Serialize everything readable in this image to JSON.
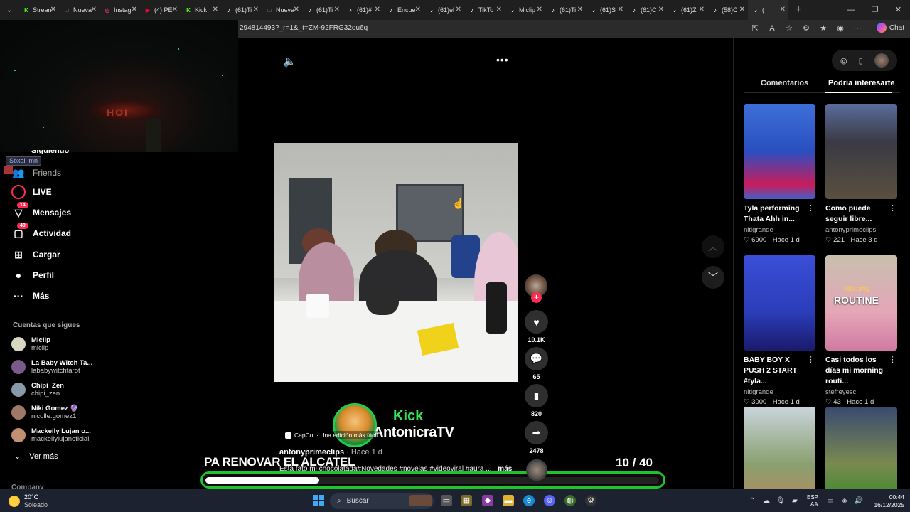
{
  "browser": {
    "tabs": [
      {
        "label": "Strean",
        "icon": "kick-icon",
        "color": "#53fc18",
        "glyph": "K"
      },
      {
        "label": "Nueva",
        "icon": "newtab-icon",
        "color": "#999999",
        "glyph": "□"
      },
      {
        "label": "Instag",
        "icon": "instagram-icon",
        "color": "#e1306c",
        "glyph": "◎"
      },
      {
        "label": "(4) PE",
        "icon": "youtube-icon",
        "color": "#ff0033",
        "glyph": "▶"
      },
      {
        "label": "Kick",
        "icon": "kick-icon",
        "color": "#53fc18",
        "glyph": "K"
      },
      {
        "label": "(61)Ti",
        "icon": "tiktok-icon",
        "color": "#ffffff",
        "glyph": "♪"
      },
      {
        "label": "Nueva",
        "icon": "newtab-icon",
        "color": "#999999",
        "glyph": "□"
      },
      {
        "label": "(61)Ti",
        "icon": "tiktok-icon",
        "color": "#ffffff",
        "glyph": "♪"
      },
      {
        "label": "(61)#",
        "icon": "tiktok-icon",
        "color": "#ffffff",
        "glyph": "♪"
      },
      {
        "label": "Encue",
        "icon": "tiktok-icon",
        "color": "#ffffff",
        "glyph": "♪"
      },
      {
        "label": "(61)el",
        "icon": "tiktok-icon",
        "color": "#ffffff",
        "glyph": "♪"
      },
      {
        "label": "TikTo",
        "icon": "tiktok-icon",
        "color": "#ffffff",
        "glyph": "♪"
      },
      {
        "label": "Miclip",
        "icon": "tiktok-icon",
        "color": "#ffffff",
        "glyph": "♪"
      },
      {
        "label": "(61)Ti",
        "icon": "tiktok-icon",
        "color": "#ffffff",
        "glyph": "♪"
      },
      {
        "label": "(61)S",
        "icon": "tiktok-icon",
        "color": "#ffffff",
        "glyph": "♪"
      },
      {
        "label": "(61)C",
        "icon": "tiktok-icon",
        "color": "#ffffff",
        "glyph": "♪"
      },
      {
        "label": "(61)Z",
        "icon": "tiktok-icon",
        "color": "#ffffff",
        "glyph": "♪"
      },
      {
        "label": "(58)C",
        "icon": "tiktok-icon",
        "color": "#ffffff",
        "glyph": "♪"
      },
      {
        "label": "(",
        "icon": "tiktok-icon",
        "color": "#ffffff",
        "glyph": "♪",
        "active": true
      }
    ],
    "url": "294814493?_r=1&_t=ZM-92FRG32ou6q",
    "copilot_label": "Chat"
  },
  "stream_overlay": {
    "username": "Sbxal_mn",
    "sign_text": "HOI"
  },
  "sidebar": {
    "partial_top": "Siguiendo",
    "nav": [
      {
        "label": "Friends",
        "icon": "friends-icon",
        "glyph": "👥",
        "dim": true
      },
      {
        "label": "LIVE",
        "icon": "live-icon",
        "glyph": ""
      },
      {
        "label": "Mensajes",
        "icon": "messages-icon",
        "glyph": "▽",
        "badge": "14"
      },
      {
        "label": "Actividad",
        "icon": "activity-icon",
        "glyph": "▢",
        "badge": "40"
      },
      {
        "label": "Cargar",
        "icon": "upload-icon",
        "glyph": "⊞"
      },
      {
        "label": "Perfil",
        "icon": "profile-icon",
        "glyph": "●"
      },
      {
        "label": "Más",
        "icon": "more-icon",
        "glyph": "···"
      }
    ],
    "following_title": "Cuentas que sigues",
    "following": [
      {
        "name": "Miclip",
        "handle": "miclip",
        "color": "#d8d8c0"
      },
      {
        "name": "La Baby Witch Ta...",
        "handle": "lababywitchtarot",
        "color": "#7a5a8a"
      },
      {
        "name": "Chipi_Zen",
        "handle": "chipi_zen",
        "color": "#8899aa"
      },
      {
        "name": "Niki Gomez 🔮",
        "handle": "nicolle.gomez1",
        "color": "#a07868"
      },
      {
        "name": "Mackeily Lujan o...",
        "handle": "mackeilylujanoficial",
        "color": "#c09070"
      }
    ],
    "see_more": "Ver más",
    "company": "Company"
  },
  "video": {
    "kick_brand": "Kick",
    "kick_channel": "AntonicraTV",
    "capcut": "CapCut · Una edición más fácil",
    "author": "antonyprimeclips",
    "time": "· Hace 1 d",
    "headline": "PA RENOVAR EL ALCATEL",
    "description": "Esta fato mi chocolatada#Novedades #novelas #videoviral #aura ...",
    "more": "más",
    "counter_current": "10",
    "counter_total": "/ 40",
    "progress": 0.25
  },
  "actions": {
    "likes": "10.1K",
    "comments": "65",
    "saves": "820",
    "shares": "2478"
  },
  "right_panel": {
    "tab_comments": "Comentarios",
    "tab_suggested": "Podría interesarte",
    "cards": [
      {
        "title": "Tyla performing Thata Ahh in...",
        "author": "nitigrande_",
        "likes": "6900",
        "time": "Hace 1 d",
        "bg": "linear-gradient(180deg,#3d6fd8 0%,#2a4fc0 50%,#c81c5c 85%,#4060c8 100%)"
      },
      {
        "title": "Como puede seguir libre...",
        "author": "antonyprimeclips",
        "likes": "221",
        "time": "Hace 3 d",
        "bg": "linear-gradient(180deg,#5a6c9a 0%,#3a3a44 40%,#5a5040 100%)"
      },
      {
        "title": "BABY BOY X PUSH 2 START #tyla...",
        "author": "nitigrande_",
        "likes": "3000",
        "time": "Hace 1 d",
        "bg": "linear-gradient(180deg,#3a4ed8 0%,#2b3db8 60%,#1a1a6a 100%)"
      },
      {
        "title": "Casi todos los días mi morning routi...",
        "author": "stefreyesc",
        "likes": "43",
        "time": "Hace 1 d",
        "bg": "linear-gradient(180deg,#c8bfae 0%,#e4a6b8 60%,#d07aa0 100%)",
        "overlay_script": "Morning",
        "overlay_big": "ROUTINE"
      },
      {
        "title": "",
        "author": "",
        "likes": "",
        "time": "",
        "bg": "linear-gradient(180deg,#c9d4dc 0%,#8aa070 60%,#b28a60 100%)"
      },
      {
        "title": "",
        "author": "",
        "likes": "",
        "time": "",
        "bg": "linear-gradient(180deg,#3a4a70 0%,#7a8a50 60%,#3a8a2a 100%)"
      }
    ]
  },
  "taskbar": {
    "temp": "20°C",
    "weather": "Soleado",
    "search": "Buscar",
    "lang1": "ESP",
    "lang2": "LAA",
    "time": "00:44",
    "date": "16/12/2025"
  }
}
